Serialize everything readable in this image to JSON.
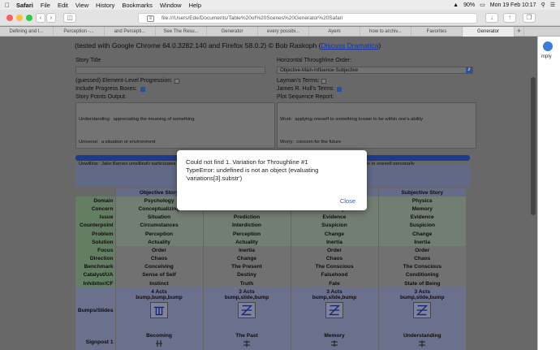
{
  "menubar": {
    "app": "Safari",
    "items": [
      "File",
      "Edit",
      "View",
      "History",
      "Bookmarks",
      "Window",
      "Help"
    ],
    "battery": "90%",
    "clock": "Mon 19 Feb 10:17"
  },
  "toolbar": {
    "url": "file:///Users/Ede/Documents/Table%20of%20Scenes%20Generator%20Safari"
  },
  "tabs": [
    "Defining and I...",
    "Perception -...",
    "and Percepti...",
    "See The Resu...",
    "Generator",
    "every possibi...",
    "Ayem",
    "how to archiv...",
    "Favorites",
    "Generator"
  ],
  "page": {
    "heading_prefix": "(tested with Google Chrome 64.0.3282.140 and Firefox 58.0.2) © Bob Raskoph (",
    "heading_link": "Discuss Dramatica",
    "heading_suffix": ")",
    "story_title_label": "Story Title",
    "horizontal_throughline_label": "Horizontal Throughline Order:",
    "horizontal_throughline_value": "Objective-Main-Influence-Subjective",
    "element_level_label": "(guessed) Element-Level Progression:",
    "include_progress_label": "Include Progress Boxes:",
    "laymans_terms_label": "Layman's Terms:",
    "james_hull_label": "James R. Hull's Terms:",
    "story_points_label": "Story Points Output:",
    "plot_sequence_label": "Plot Sequence Report:",
    "story_points_text": [
      "Understanding:  appreciating the meaning of something",
      "Universe:  a situation or environment",
      "Unwilling:  Jake Barnes unwillingly participates in the effort to find a solution to the story problem"
    ],
    "plot_sequence_text": [
      "Work:  applying oneself to something known to be within one's ability",
      "Worry:  concern for the future",
      "Worth:  a rating of usefulness or desirability to oneself personally"
    ]
  },
  "grid": {
    "headers": [
      "Objective Story",
      "",
      "",
      "Subjective Story"
    ],
    "rows": [
      {
        "label": "Domain",
        "cells": [
          "Psychology",
          "",
          "",
          "Physics"
        ],
        "green": true
      },
      {
        "label": "Concern",
        "cells": [
          "Conceptualizing",
          "The Past",
          "Memory",
          "Memory"
        ],
        "green": true
      },
      {
        "label": "Issue",
        "cells": [
          "Situation",
          "Prediction",
          "Evidence",
          "Evidence"
        ],
        "green": true
      },
      {
        "label": "Counterpoint",
        "cells": [
          "Circumstances",
          "Interdiction",
          "Suspicion",
          "Suspicion"
        ],
        "green": true
      },
      {
        "label": "Problem",
        "cells": [
          "Perception",
          "Perception",
          "Change",
          "Change"
        ],
        "green": true
      },
      {
        "label": "Solution",
        "cells": [
          "Actuality",
          "Actuality",
          "Inertia",
          "Inertia"
        ],
        "green": true
      },
      {
        "label": "Focus",
        "cells": [
          "Order",
          "Inertia",
          "Order",
          "Order"
        ],
        "green": false
      },
      {
        "label": "Direction",
        "cells": [
          "Chaos",
          "Change",
          "Chaos",
          "Chaos"
        ],
        "green": false
      },
      {
        "label": "Benchmark",
        "cells": [
          "Conceiving",
          "The Present",
          "The Conscious",
          "The Conscious"
        ],
        "green": false
      },
      {
        "label": "Catalyst/UA",
        "cells": [
          "Sense of Self",
          "Destiny",
          "Falsehood",
          "Conditioning"
        ],
        "green": false
      },
      {
        "label": "Inhibitor/CF",
        "cells": [
          "Instinct",
          "Truth",
          "Fate",
          "State of Being"
        ],
        "green": false
      }
    ],
    "bumps": {
      "label": "Bumps/Slides",
      "cells": [
        {
          "acts": "4 Acts",
          "pattern": "bump,bump,bump",
          "glyph": "bump-pattern-icon"
        },
        {
          "acts": "3 Acts",
          "pattern": "bump,slide,bump",
          "glyph": "z-pattern-icon"
        },
        {
          "acts": "3 Acts",
          "pattern": "bump,slide,bump",
          "glyph": "z-pattern-icon"
        },
        {
          "acts": "3 Acts",
          "pattern": "bump,slide,bump",
          "glyph": "z-pattern-icon"
        }
      ]
    },
    "signpost": {
      "label": "Signpost 1",
      "cells": [
        "Becoming",
        "The Past",
        "Memory",
        "Understanding"
      ]
    }
  },
  "dialog": {
    "message": "Could not find 1. Variation for Throughline #1\nTypeError: undefined is not an object (evaluating 'variations[3].substr')",
    "close_label": "Close"
  },
  "sidebar_right": {
    "label": "mply"
  }
}
